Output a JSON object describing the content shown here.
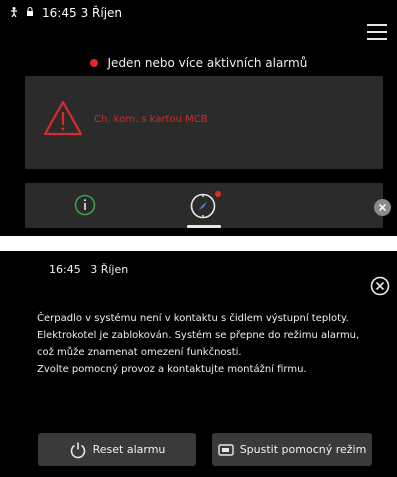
{
  "top": {
    "status_time": "16:45",
    "status_date": "3 Říjen",
    "alarm_status": "Jeden nebo více aktivních alarmů",
    "alarm_text": "Ch. kom. s kartou MCB"
  },
  "bottom": {
    "status_time": "16:45",
    "status_date": "3  Říjen",
    "message_lines": [
      "Čerpadlo v systému není v kontaktu s čidlem výstupní teploty.",
      "Elektrokotel je zablokován. Systém se přepne do režimu alarmu,",
      "což může znamenat omezení funkčnosti.",
      "Zvolte pomocný provoz a kontaktujte montážní firmu."
    ],
    "buttons": {
      "reset": "Reset alarmu",
      "aux": "Spustit pomocný režim"
    }
  },
  "colors": {
    "alarm_red": "#e02a2a",
    "panel_bg": "#000000",
    "card_bg": "#2b2b2b",
    "info_green": "#3aa04a",
    "compass_blue": "#3a7bd5"
  }
}
